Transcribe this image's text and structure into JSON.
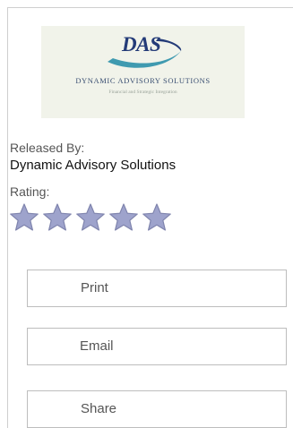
{
  "logo": {
    "mark_text": "DAS",
    "company_text": "DYNAMIC ADVISORY SOLUTIONS",
    "tagline_text": "Financial and Strategic Integration",
    "colors": {
      "navy": "#243b78",
      "teal": "#3f9ab0",
      "background": "#f1f3ea"
    }
  },
  "released": {
    "label": "Released By:",
    "value": "Dynamic Advisory Solutions"
  },
  "rating": {
    "label": "Rating:",
    "stars_filled": 5,
    "stars_total": 5,
    "star_color": "#9ea3cc"
  },
  "actions": {
    "print_label": "Print",
    "email_label": "Email",
    "share_label": "Share"
  }
}
